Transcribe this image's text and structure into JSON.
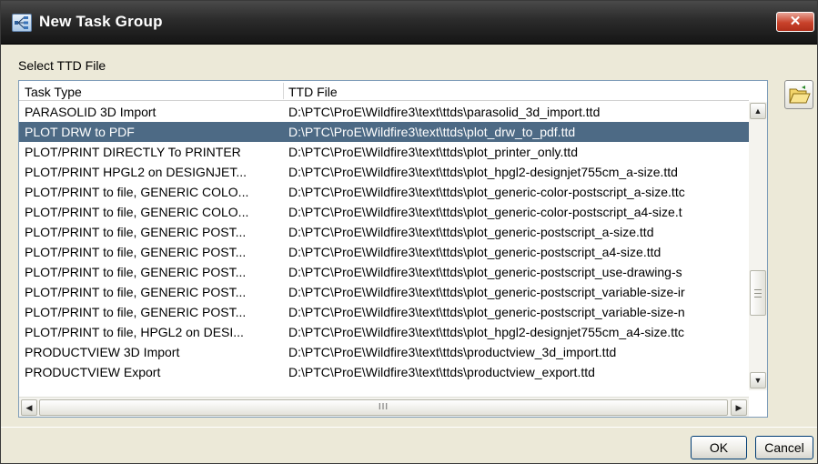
{
  "window": {
    "title": "New Task Group",
    "close_label": "✕"
  },
  "section_label": "Select TTD File",
  "table": {
    "columns": [
      "Task Type",
      "TTD File"
    ],
    "selected_index": 1,
    "rows": [
      {
        "type": "PARASOLID 3D Import",
        "file": "D:\\PTC\\ProE\\Wildfire3\\text\\ttds\\parasolid_3d_import.ttd"
      },
      {
        "type": "PLOT DRW to PDF",
        "file": "D:\\PTC\\ProE\\Wildfire3\\text\\ttds\\plot_drw_to_pdf.ttd"
      },
      {
        "type": "PLOT/PRINT DIRECTLY To PRINTER",
        "file": "D:\\PTC\\ProE\\Wildfire3\\text\\ttds\\plot_printer_only.ttd"
      },
      {
        "type": "PLOT/PRINT HPGL2 on DESIGNJET...",
        "file": "D:\\PTC\\ProE\\Wildfire3\\text\\ttds\\plot_hpgl2-designjet755cm_a-size.ttd"
      },
      {
        "type": "PLOT/PRINT to file, GENERIC COLO...",
        "file": "D:\\PTC\\ProE\\Wildfire3\\text\\ttds\\plot_generic-color-postscript_a-size.ttc"
      },
      {
        "type": "PLOT/PRINT to file, GENERIC COLO...",
        "file": "D:\\PTC\\ProE\\Wildfire3\\text\\ttds\\plot_generic-color-postscript_a4-size.t"
      },
      {
        "type": "PLOT/PRINT to file, GENERIC POST...",
        "file": "D:\\PTC\\ProE\\Wildfire3\\text\\ttds\\plot_generic-postscript_a-size.ttd"
      },
      {
        "type": "PLOT/PRINT to file, GENERIC POST...",
        "file": "D:\\PTC\\ProE\\Wildfire3\\text\\ttds\\plot_generic-postscript_a4-size.ttd"
      },
      {
        "type": "PLOT/PRINT to file, GENERIC POST...",
        "file": "D:\\PTC\\ProE\\Wildfire3\\text\\ttds\\plot_generic-postscript_use-drawing-s"
      },
      {
        "type": "PLOT/PRINT to file, GENERIC POST...",
        "file": "D:\\PTC\\ProE\\Wildfire3\\text\\ttds\\plot_generic-postscript_variable-size-ir"
      },
      {
        "type": "PLOT/PRINT to file, GENERIC POST...",
        "file": "D:\\PTC\\ProE\\Wildfire3\\text\\ttds\\plot_generic-postscript_variable-size-n"
      },
      {
        "type": "PLOT/PRINT to file, HPGL2 on DESI...",
        "file": "D:\\PTC\\ProE\\Wildfire3\\text\\ttds\\plot_hpgl2-designjet755cm_a4-size.ttc"
      },
      {
        "type": "PRODUCTVIEW 3D Import",
        "file": "D:\\PTC\\ProE\\Wildfire3\\text\\ttds\\productview_3d_import.ttd"
      },
      {
        "type": "PRODUCTVIEW Export",
        "file": "D:\\PTC\\ProE\\Wildfire3\\text\\ttds\\productview_export.ttd"
      }
    ]
  },
  "scrollbars": {
    "up": "▲",
    "down": "▼",
    "left": "◀",
    "right": "▶",
    "vgrip": "≡",
    "hgrip": "III"
  },
  "buttons": {
    "ok": "OK",
    "cancel": "Cancel"
  },
  "colors": {
    "selection": "#4d6a85",
    "titlebar": "#2b2b2b",
    "close": "#c8422a",
    "dialog_bg": "#ece9d8"
  },
  "icons": {
    "app": "task-group-icon",
    "browse": "open-folder-icon"
  }
}
